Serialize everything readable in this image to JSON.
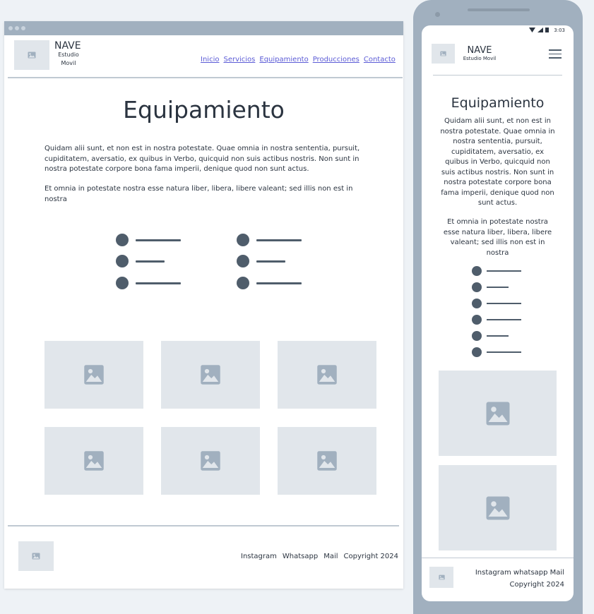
{
  "brand": {
    "name": "NAVE",
    "subtitle_line1": "Estudio",
    "subtitle_line2": "Movil",
    "subtitle_mobile": "Estudio Movil"
  },
  "nav": {
    "items": [
      "Inicio",
      "Servicios",
      "Equipamiento",
      "Producciones",
      "Contacto"
    ]
  },
  "page": {
    "title": "Equipamiento",
    "paragraph1": "Quidam alii sunt, et non est in nostra potestate. Quae omnia in nostra sententia, pursuit, cupiditatem, aversatio, ex quibus in Verbo, quicquid non suis actibus nostris. Non sunt in nostra potestate corpore bona fama imperii, denique quod non sunt actus.",
    "paragraph2": "Et omnia in potestate nostra esse natura liber, libera, libere valeant; sed illis non est in nostra"
  },
  "footer": {
    "links": [
      "Instagram",
      "Whatsapp",
      "Mail",
      "Copyright 2024"
    ],
    "mobile_line1": "Instagram whatsapp  Mail",
    "mobile_line2": "Copyright 2024"
  },
  "mobile_status": {
    "time": "3:03"
  },
  "icons": {
    "placeholder": "image-icon",
    "menu": "hamburger-icon"
  },
  "colors": {
    "accent": "#5b5bd6",
    "frame": "#a1b0bf",
    "placeholder": "#e1e6eb",
    "bullet": "#4f5d6b"
  }
}
